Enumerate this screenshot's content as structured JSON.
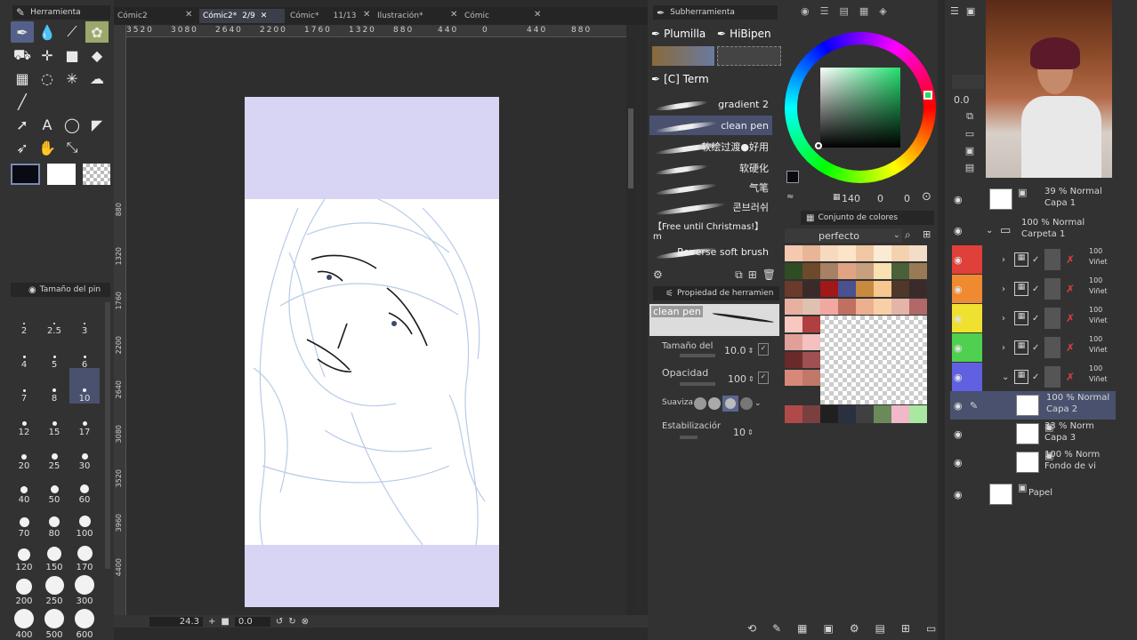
{
  "tabs": {
    "tool_panel_title": "Herramienta",
    "doc_tabs": [
      "Cómic2",
      "Cómic2*",
      "2/9",
      "Cómic*",
      "11/13",
      "Ilustración*",
      "Cómic"
    ],
    "subtool_title": "Subherramienta"
  },
  "ruler": {
    "top_ticks": [
      "3520",
      "3080",
      "2640",
      "2200",
      "1760",
      "1320",
      "880",
      "440",
      "0",
      "440",
      "880"
    ],
    "left_ticks": [
      "880",
      "1320",
      "1760",
      "2200",
      "2640",
      "3080",
      "3520",
      "3960",
      "4400"
    ]
  },
  "tools": {
    "brush_size_title": "Tamaño del pin",
    "sizes": [
      "2",
      "2.5",
      "3",
      "4",
      "5",
      "6",
      "7",
      "8",
      "10",
      "12",
      "15",
      "17",
      "20",
      "25",
      "30",
      "40",
      "50",
      "60",
      "70",
      "80",
      "100",
      "120",
      "150",
      "170",
      "200",
      "250",
      "300",
      "400",
      "500",
      "600"
    ],
    "selected_size": "10"
  },
  "subtool": {
    "groups": [
      "Plumilla",
      "HiBipen"
    ],
    "term_group": "[C] Term",
    "brushes": [
      "gradient 2",
      "clean pen",
      "软绘过渡●好用",
      "软硬化",
      "气笔",
      "콘브러쉬",
      "【Free until Christmas!】m",
      "Reverse soft brush"
    ],
    "selected_brush": "clean pen"
  },
  "tool_property": {
    "title": "Propiedad de herramien",
    "brush_name": "clean pen",
    "size_label": "Tamaño del p",
    "size_value": "10.0",
    "opacity_label": "Opacidad",
    "opacity_value": "100",
    "softness_label": "Suaviza",
    "stabilization_label": "Estabilización",
    "stabilization_value": "10"
  },
  "color": {
    "hsv_readout": [
      "140",
      "0",
      "0"
    ],
    "color_set_title": "Conjunto de colores",
    "color_set_name": "perfecto",
    "swatches": [
      "#f4c9b0",
      "#e8b596",
      "#f7d9c0",
      "#fde3c8",
      "#f0c8a4",
      "#fcebd4",
      "#f4d2b0",
      "#f3ddc9",
      "#2f4d25",
      "#6c4a2a",
      "#a88064",
      "#e0a484",
      "#c8a080",
      "#fbe0b0",
      "#4a6038",
      "#9a7a54",
      "#6a3a2a",
      "#3a2a2a",
      "#a01818",
      "#4a5090",
      "#c88a40",
      "#f6c890",
      "#503828",
      "#3a2a2a",
      "#e8b0a0",
      "#e0c0b0",
      "#f0a8a0",
      "#c07060",
      "#eab090",
      "#f8d0a8",
      "#e4b4a8",
      "#b06868",
      "#f8c8c0",
      "#b04040",
      "#c83048",
      "#e8e8e8"
    ]
  },
  "layers": {
    "rows": [
      {
        "opacity": "39 % Normal",
        "name": "Capa 1"
      },
      {
        "opacity": "100 % Normal",
        "name": "Carpeta 1"
      },
      {
        "opacity": "100",
        "name": "Viñet"
      },
      {
        "opacity": "100",
        "name": "Viñet"
      },
      {
        "opacity": "100",
        "name": "Viñet"
      },
      {
        "opacity": "100",
        "name": "Viñet"
      },
      {
        "opacity": "100",
        "name": "Viñet"
      },
      {
        "opacity": "100 % Normal",
        "name": "Capa 2"
      },
      {
        "opacity": "33 % Norm",
        "name": "Capa 3"
      },
      {
        "opacity": "100 % Norm",
        "name": "Fondo de vi"
      },
      {
        "opacity": "",
        "name": "Papel"
      }
    ],
    "opacity_field": "0.0",
    "strip_colors": [
      "#e0403a",
      "#f08a30",
      "#f0e030",
      "#50d050",
      "#6060e0"
    ]
  },
  "status": {
    "zoom": "24.3",
    "rotation": "0.0"
  }
}
